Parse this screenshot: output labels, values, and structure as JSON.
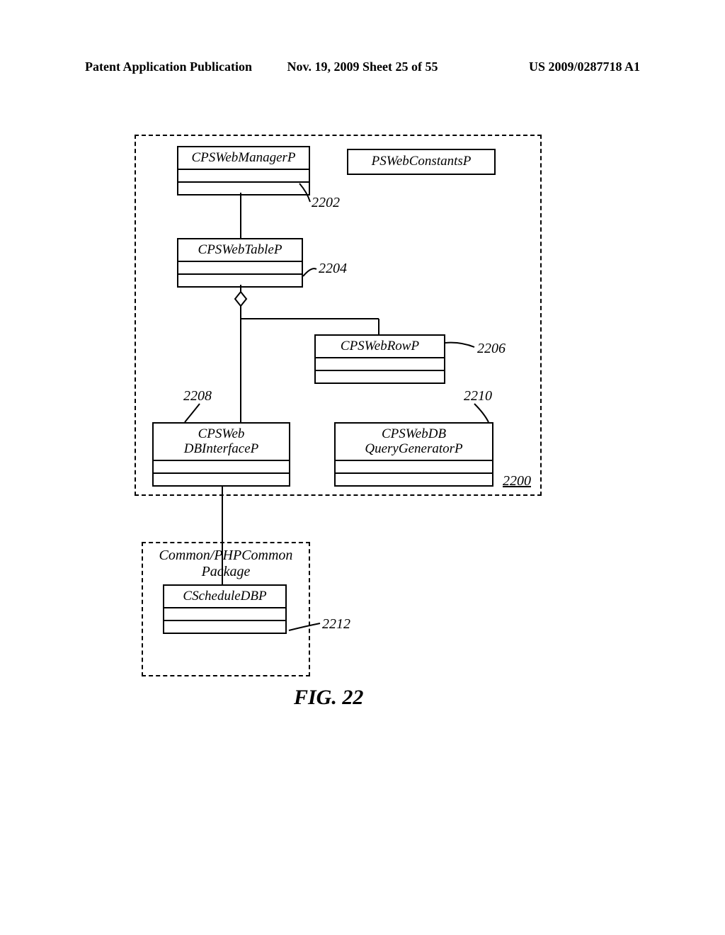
{
  "header": {
    "left": "Patent Application Publication",
    "center": "Nov. 19, 2009  Sheet 25 of 55",
    "right": "US 2009/0287718 A1"
  },
  "packages": {
    "main_ref": "2200",
    "common": {
      "title_l1": "Common/PHPCommon",
      "title_l2": "Package"
    }
  },
  "classes": {
    "manager": {
      "name": "CPSWebManagerP",
      "ref": "2202"
    },
    "constants": {
      "name": "PSWebConstantsP"
    },
    "table": {
      "name": "CPSWebTableP",
      "ref": "2204"
    },
    "row": {
      "name": "CPSWebRowP",
      "ref": "2206"
    },
    "dbi": {
      "l1": "CPSWeb",
      "l2": "DBInterfaceP",
      "ref": "2208"
    },
    "qgen": {
      "l1": "CPSWebDB",
      "l2": "QueryGeneratorP",
      "ref": "2210"
    },
    "sched": {
      "name": "CScheduleDBP",
      "ref": "2212"
    }
  },
  "figure_caption": "FIG. 22"
}
